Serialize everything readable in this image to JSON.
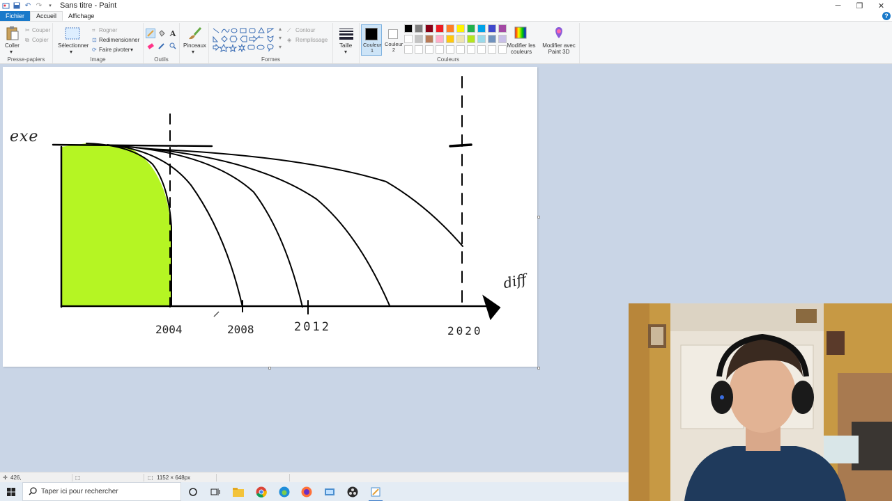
{
  "window": {
    "title": "Sans titre - Paint"
  },
  "menu": {
    "file": "Fichier",
    "home": "Accueil",
    "view": "Affichage"
  },
  "ribbon": {
    "clipboard": {
      "label": "Presse-papiers",
      "paste": "Coller",
      "cut": "Couper",
      "copy": "Copier"
    },
    "image": {
      "label": "Image",
      "select": "Sélectionner",
      "crop": "Rogner",
      "resize": "Redimensionner",
      "rotate": "Faire pivoter"
    },
    "tools": {
      "label": "Outils"
    },
    "brushes": {
      "label": "Pinceaux"
    },
    "shapes": {
      "label": "Formes",
      "outline": "Contour",
      "fill": "Remplissage"
    },
    "size": {
      "label": "Taille"
    },
    "colors": {
      "label": "Couleurs",
      "color1": "Couleur 1",
      "color2": "Couleur 2",
      "edit": "Modifier les couleurs",
      "paint3d": "Modifier avec Paint 3D",
      "color1_value": "#000000",
      "color2_value": "#ffffff",
      "palette": [
        "#000000",
        "#7f7f7f",
        "#880015",
        "#ed1c24",
        "#ff7f27",
        "#fff200",
        "#22b14c",
        "#00a2e8",
        "#3f48cc",
        "#a349a4",
        "#ffffff",
        "#c3c3c3",
        "#b97a57",
        "#ffaec9",
        "#ffc90e",
        "#efe4b0",
        "#b5e61d",
        "#99d9ea",
        "#7092be",
        "#c8bfe7"
      ]
    }
  },
  "drawing": {
    "axis_y_label": "exe",
    "axis_x_label": "diff",
    "years": [
      "2004",
      "2008",
      "2012",
      "2020"
    ],
    "fill_color": "#b5f523"
  },
  "status": {
    "cursor": "426,",
    "dimensions": "1152 × 648px"
  },
  "taskbar": {
    "search_placeholder": "Taper ici pour rechercher"
  }
}
